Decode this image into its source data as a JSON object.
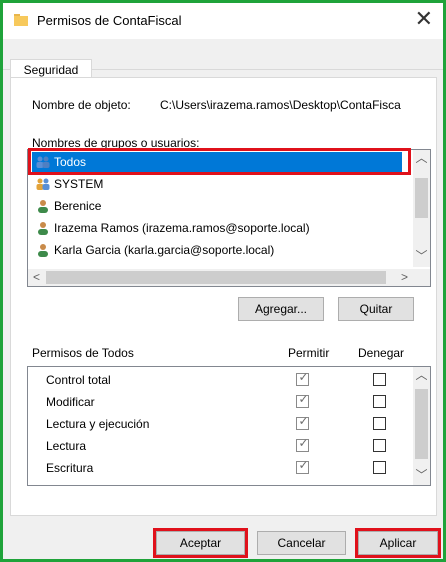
{
  "window": {
    "title": "Permisos de ContaFiscal",
    "close_glyph": "✕"
  },
  "tabs": [
    {
      "label": "Seguridad"
    }
  ],
  "object": {
    "label": "Nombre de objeto:",
    "value": "C:\\Users\\irazema.ramos\\Desktop\\ContaFisca"
  },
  "groups": {
    "label": "Nombres de grupos o usuarios:",
    "items": [
      {
        "name": "Todos",
        "icon": "group-icon",
        "selected": true
      },
      {
        "name": "SYSTEM",
        "icon": "system-group-icon",
        "selected": false
      },
      {
        "name": "Berenice",
        "icon": "user-icon",
        "selected": false
      },
      {
        "name": "Irazema Ramos (irazema.ramos@soporte.local)",
        "icon": "user-icon",
        "selected": false
      },
      {
        "name": "Karla Garcia (karla.garcia@soporte.local)",
        "icon": "user-icon",
        "selected": false
      }
    ]
  },
  "buttons": {
    "add": "Agregar...",
    "remove": "Quitar"
  },
  "permissions": {
    "label": "Permisos de Todos",
    "allow_header": "Permitir",
    "deny_header": "Denegar",
    "rows": [
      {
        "name": "Control total",
        "allow": true,
        "deny": false
      },
      {
        "name": "Modificar",
        "allow": true,
        "deny": false
      },
      {
        "name": "Lectura y ejecución",
        "allow": true,
        "deny": false
      },
      {
        "name": "Lectura",
        "allow": true,
        "deny": false
      },
      {
        "name": "Escritura",
        "allow": true,
        "deny": false
      }
    ]
  },
  "footer": {
    "ok": "Aceptar",
    "cancel": "Cancelar",
    "apply": "Aplicar"
  },
  "colors": {
    "selection": "#0078d7",
    "highlight_box": "#e0111b",
    "frame": "#1fa33a"
  }
}
